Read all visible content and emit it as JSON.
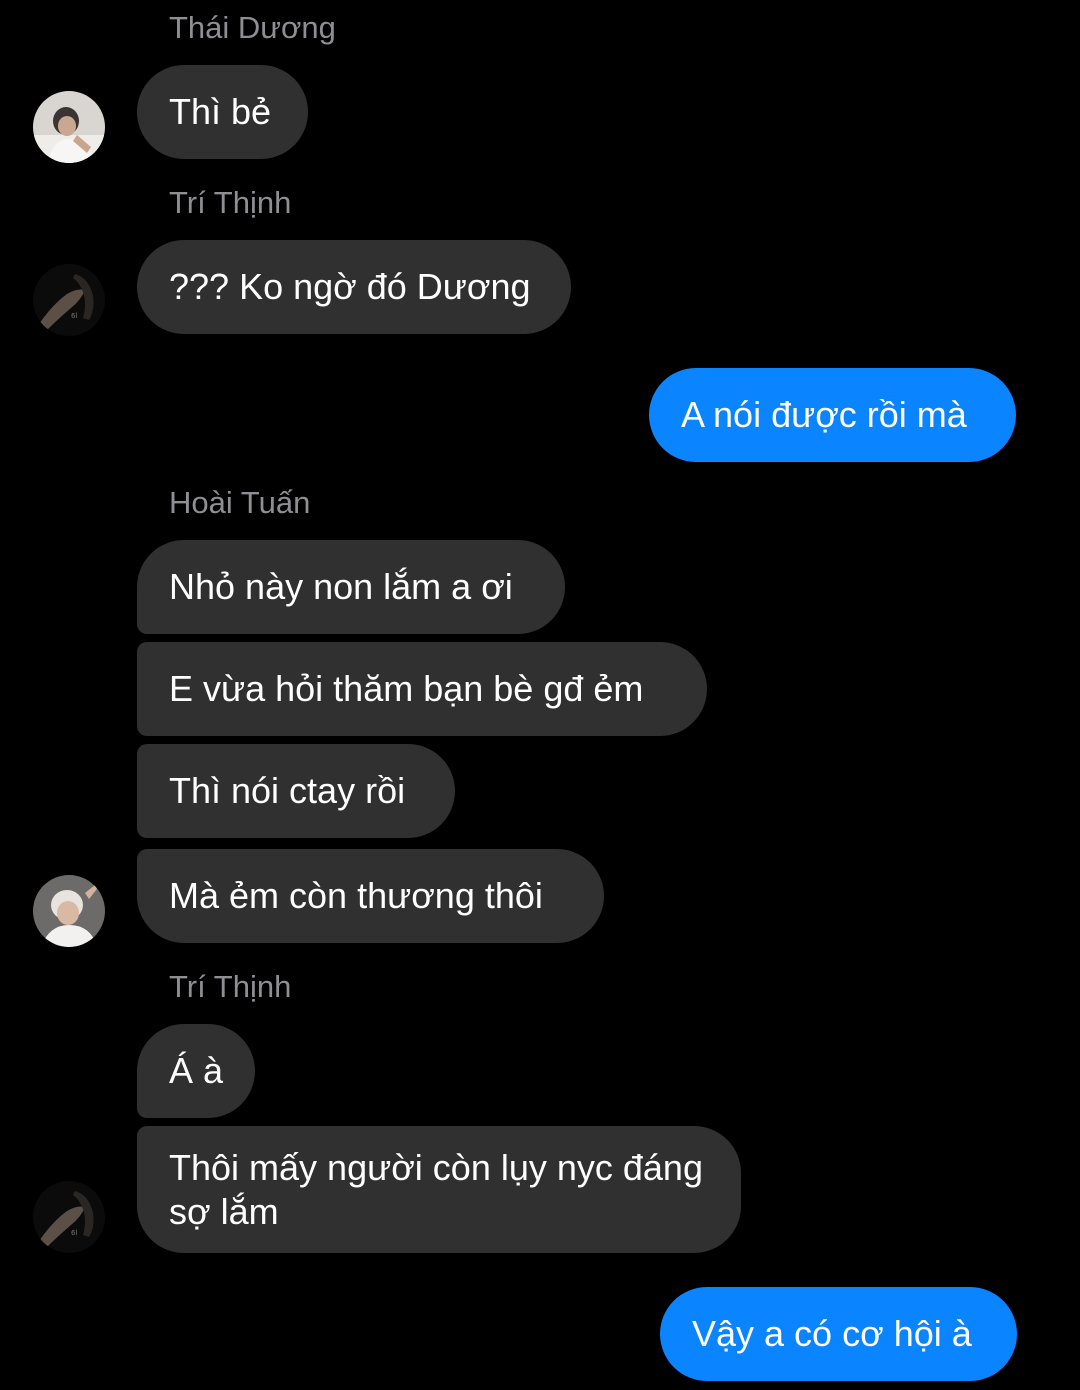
{
  "colors": {
    "background": "#000000",
    "incoming_bubble": "#303030",
    "outgoing_bubble": "#0a84ff",
    "sender_name": "#8e8e93",
    "text": "#ffffff"
  },
  "messages": [
    {
      "sender": "Thái Dương",
      "text": "Thì bẻ",
      "direction": "incoming",
      "avatar": "avatar-thai-duong"
    },
    {
      "sender": "Trí Thịnh",
      "text": "??? Ko ngờ đó Dương",
      "direction": "incoming",
      "avatar": "avatar-tri-thinh"
    },
    {
      "text": "A nói được rồi mà",
      "direction": "outgoing"
    },
    {
      "sender": "Hoài Tuấn",
      "text": "Nhỏ này non lắm a ơi",
      "direction": "incoming"
    },
    {
      "text": "E vừa hỏi thăm bạn bè gđ ẻm",
      "direction": "incoming"
    },
    {
      "text": "Thì nói ctay rồi",
      "direction": "incoming"
    },
    {
      "text": "Mà ẻm còn thương thôi",
      "direction": "incoming",
      "avatar": "avatar-hoai-tuan"
    },
    {
      "sender": "Trí Thịnh",
      "text": "Á à",
      "direction": "incoming"
    },
    {
      "text": "Thôi mấy người còn lụy nyc đáng sợ lắm",
      "direction": "incoming",
      "avatar": "avatar-tri-thinh"
    },
    {
      "text": "Vậy a có cơ hội à",
      "direction": "outgoing"
    }
  ]
}
